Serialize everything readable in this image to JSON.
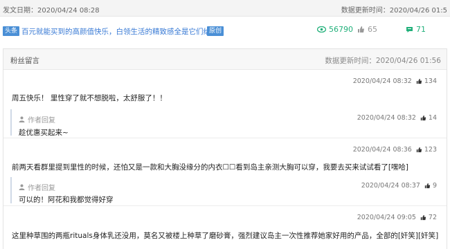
{
  "header": {
    "publish_date": "发文日期：2020/04/24 08:28",
    "update_time": "数据更新时间：2020/04/26 01:5"
  },
  "article": {
    "tag": "头条",
    "title": "百元就能买到的高颜值快乐，白领生活的精致感全是它们给的！",
    "original_badge": "原创",
    "reads": "56790",
    "likes": "65",
    "comments": "71"
  },
  "panel": {
    "title": "粉丝留言",
    "update_time": "数据更新时间：2020/04/26 01:56"
  },
  "comments": [
    {
      "time": "2020/04/24 08:32",
      "likes": "134",
      "text": "周五快乐！ 里性穿了就不想脱啦，太舒服了！！",
      "reply": {
        "label": "作者回复",
        "time": "2020/04/24 08:32",
        "likes": "14",
        "text": "趁优惠买起来~"
      }
    },
    {
      "time": "2020/04/24 08:36",
      "likes": "123",
      "text": "前两天看群里提到里性的时候，还怕又是一款和大胸没缘分的内衣☐☐看到岛主亲测大胸可以穿，我要去买来试试看了[嘿哈]",
      "reply": {
        "label": "作者回复",
        "time": "2020/04/24 08:37",
        "likes": "9",
        "text": "可以的！阿花和我都觉得好穿"
      }
    },
    {
      "time": "2020/04/24 09:05",
      "likes": "72",
      "text": "这里种草围的两瓶rituals身体乳还没用，莫名又被楼上种草了磨砂膏，强烈建议岛主一次性推荐她家好用的产品，全部的[奸笑][奸笑]"
    }
  ]
}
